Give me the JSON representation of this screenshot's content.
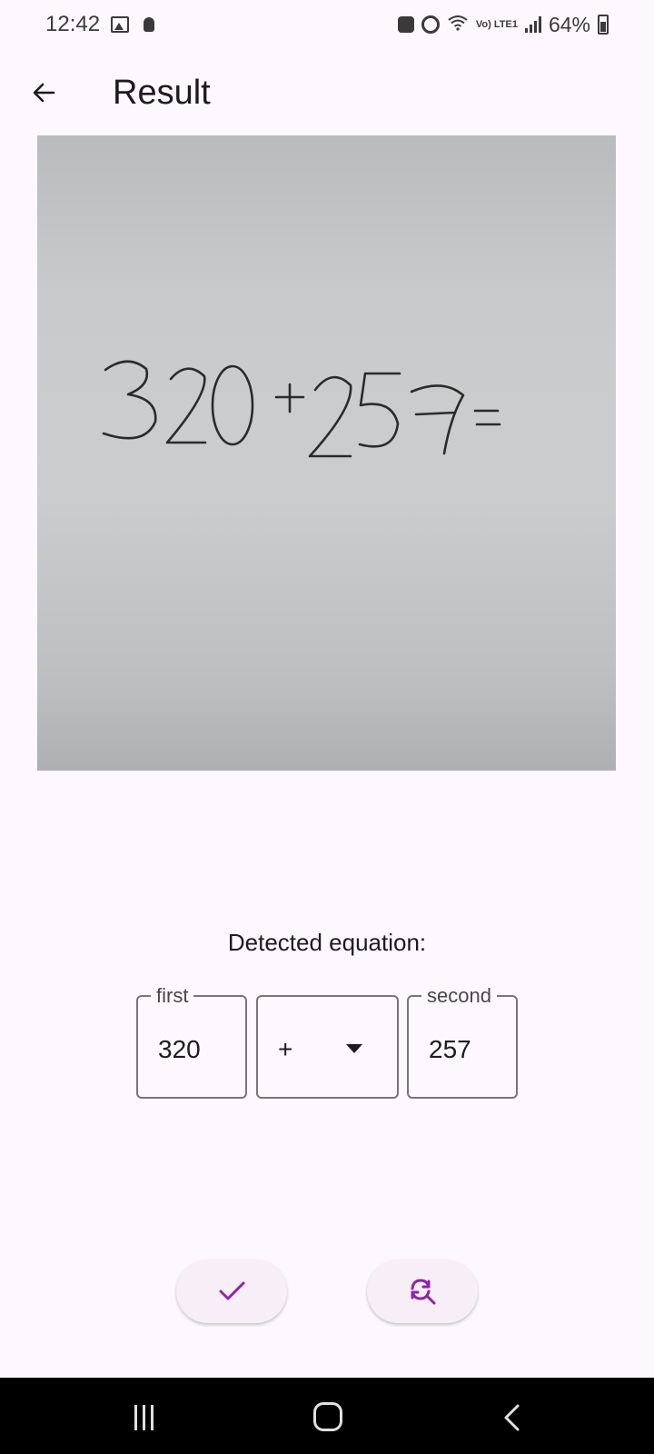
{
  "status_bar": {
    "time": "12:42",
    "battery": "64%",
    "network": "Vo) LTE1",
    "icons": [
      "gallery-icon",
      "lightbulb-icon",
      "sync-icon",
      "alarm-icon",
      "wifi-icon",
      "signal-icon",
      "battery-icon"
    ]
  },
  "app_bar": {
    "title": "Result",
    "back_icon": "arrow-back-icon"
  },
  "photo": {
    "handwritten_text": "320+257=",
    "description_icon": "captured-photo"
  },
  "equation": {
    "label": "Detected equation:",
    "first": {
      "label": "first",
      "value": "320"
    },
    "operator": {
      "value": "+"
    },
    "second": {
      "label": "second",
      "value": "257"
    }
  },
  "actions": {
    "confirm_icon": "check-icon",
    "rescan_icon": "rescan-search-icon"
  },
  "nav_bar": {
    "icons": [
      "recents-icon",
      "home-icon",
      "back-icon"
    ]
  },
  "colors": {
    "accent": "#8e24aa",
    "background": "#fdf8fd",
    "button_bg": "#f7eef8",
    "outline": "#79747e"
  }
}
